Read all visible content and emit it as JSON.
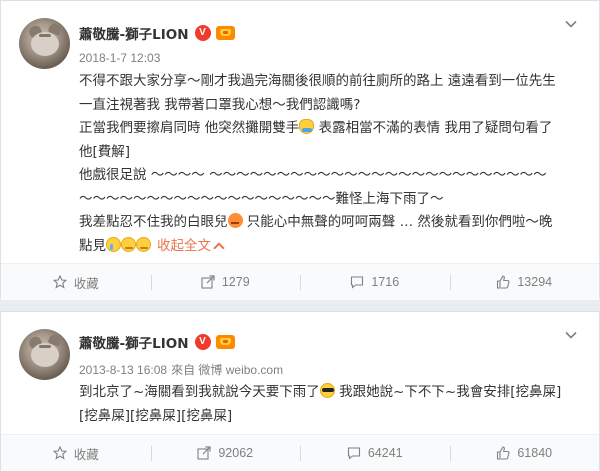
{
  "posts": [
    {
      "user": {
        "name": "蕭敬騰-獅子LION",
        "verified_badge": "V"
      },
      "meta": {
        "time": "2018-1-7 12:03",
        "source": ""
      },
      "lines": [
        "不得不跟大家分享～剛才我過完海關後很順的前往廁所的路上 遠遠看到一位先生",
        "一直注視著我 我帶著口罩我心想～我們認識嗎?",
        "正當我們要擦肩同時 他突然攤開雙手",
        " 表露相當不滿的表情 我用了疑問句看了",
        "他[費解]",
        "他戲很足說 ～～～～ ～～～～～～～～～～～～～～～～～～～～～～～～～",
        "～～～～～～～～～～～～～～～～～～～難怪上海下雨了～",
        "我差點忍不住我的白眼兒",
        " 只能心中無聲的呵呵兩聲 … 然後就看到你們啦～晚",
        "點見"
      ],
      "collapse_label": "收起全文",
      "actions": [
        {
          "label": "收藏",
          "icon": "star-icon"
        },
        {
          "label": "1279",
          "icon": "share-icon"
        },
        {
          "label": "1716",
          "icon": "comment-icon"
        },
        {
          "label": "13294",
          "icon": "like-icon"
        }
      ]
    },
    {
      "user": {
        "name": "蕭敬騰-獅子LION",
        "verified_badge": "V"
      },
      "meta": {
        "time": "2013-8-13 16:08",
        "source": "來自 微博 weibo.com"
      },
      "lines": [
        "到北京了~海關看到我就說今天要下雨了",
        " 我跟她說~下不下~我會安排[挖鼻屎]",
        "[挖鼻屎][挖鼻屎][挖鼻屎]"
      ],
      "actions": [
        {
          "label": "收藏",
          "icon": "star-icon"
        },
        {
          "label": "92062",
          "icon": "share-icon"
        },
        {
          "label": "64241",
          "icon": "comment-icon"
        },
        {
          "label": "61840",
          "icon": "like-icon"
        }
      ]
    }
  ],
  "colors": {
    "accent": "#eb7350",
    "verified": "#f03a2a",
    "member": "#ff8a00",
    "muted": "#808080"
  }
}
